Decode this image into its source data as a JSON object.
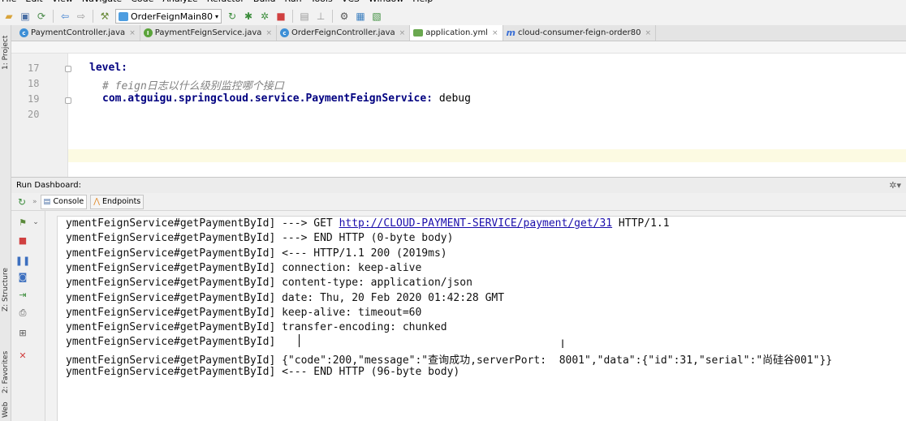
{
  "menu": [
    "File",
    "Edit",
    "View",
    "Navigate",
    "Code",
    "Analyze",
    "Refactor",
    "Build",
    "Run",
    "Tools",
    "VCS",
    "Window",
    "Help"
  ],
  "toolbar": {
    "run_config": "OrderFeignMain80"
  },
  "left_strip": {
    "project": "1: Project",
    "structure": "Z: Structure",
    "favorites": "2: Favorites",
    "web": "Web"
  },
  "editor_tabs": [
    {
      "label": "PaymentController.java",
      "icon": "c-class-icon"
    },
    {
      "label": "PaymentFeignService.java",
      "icon": "i-interface-icon"
    },
    {
      "label": "OrderFeignController.java",
      "icon": "c-class-icon"
    },
    {
      "label": "application.yml",
      "icon": "yml-icon",
      "active": true
    },
    {
      "label": "cloud-consumer-feign-order80",
      "icon": "maven-m-icon"
    }
  ],
  "editor": {
    "lines": [
      {
        "num": "17",
        "text": "level:"
      },
      {
        "num": "18",
        "text": "# feign日志以什么级别监控哪个接口"
      },
      {
        "num": "19",
        "key": "com.atguigu.springcloud.service.PaymentFeignService:",
        "value": " debug"
      },
      {
        "num": "20",
        "text": ""
      }
    ]
  },
  "run_dashboard": {
    "title": "Run Dashboard:",
    "tabs": {
      "console": "Console",
      "endpoints": "Endpoints"
    }
  },
  "console": {
    "prefix": "ymentFeignService#getPaymentById] ",
    "lines": [
      {
        "text": "---> GET ",
        "link": "http://CLOUD-PAYMENT-SERVICE/payment/get/31",
        "suffix": " HTTP/1.1"
      },
      {
        "text": "---> END HTTP (0-byte body)"
      },
      {
        "text": "<--- HTTP/1.1 200 (2019ms)"
      },
      {
        "text": "connection: keep-alive"
      },
      {
        "text": "content-type: application/json"
      },
      {
        "text": "date: Thu, 20 Feb 2020 01:42:28 GMT"
      },
      {
        "text": "keep-alive: timeout=60"
      },
      {
        "text": "transfer-encoding: chunked"
      },
      {
        "text": ""
      },
      {
        "text": "{\"code\":200,\"message\":\"查询成功,serverPort:  8001\",\"data\":{\"id\":31,\"serial\":\"尚硅谷001\"}}"
      },
      {
        "text": "<--- END HTTP (96-byte body)"
      }
    ]
  }
}
